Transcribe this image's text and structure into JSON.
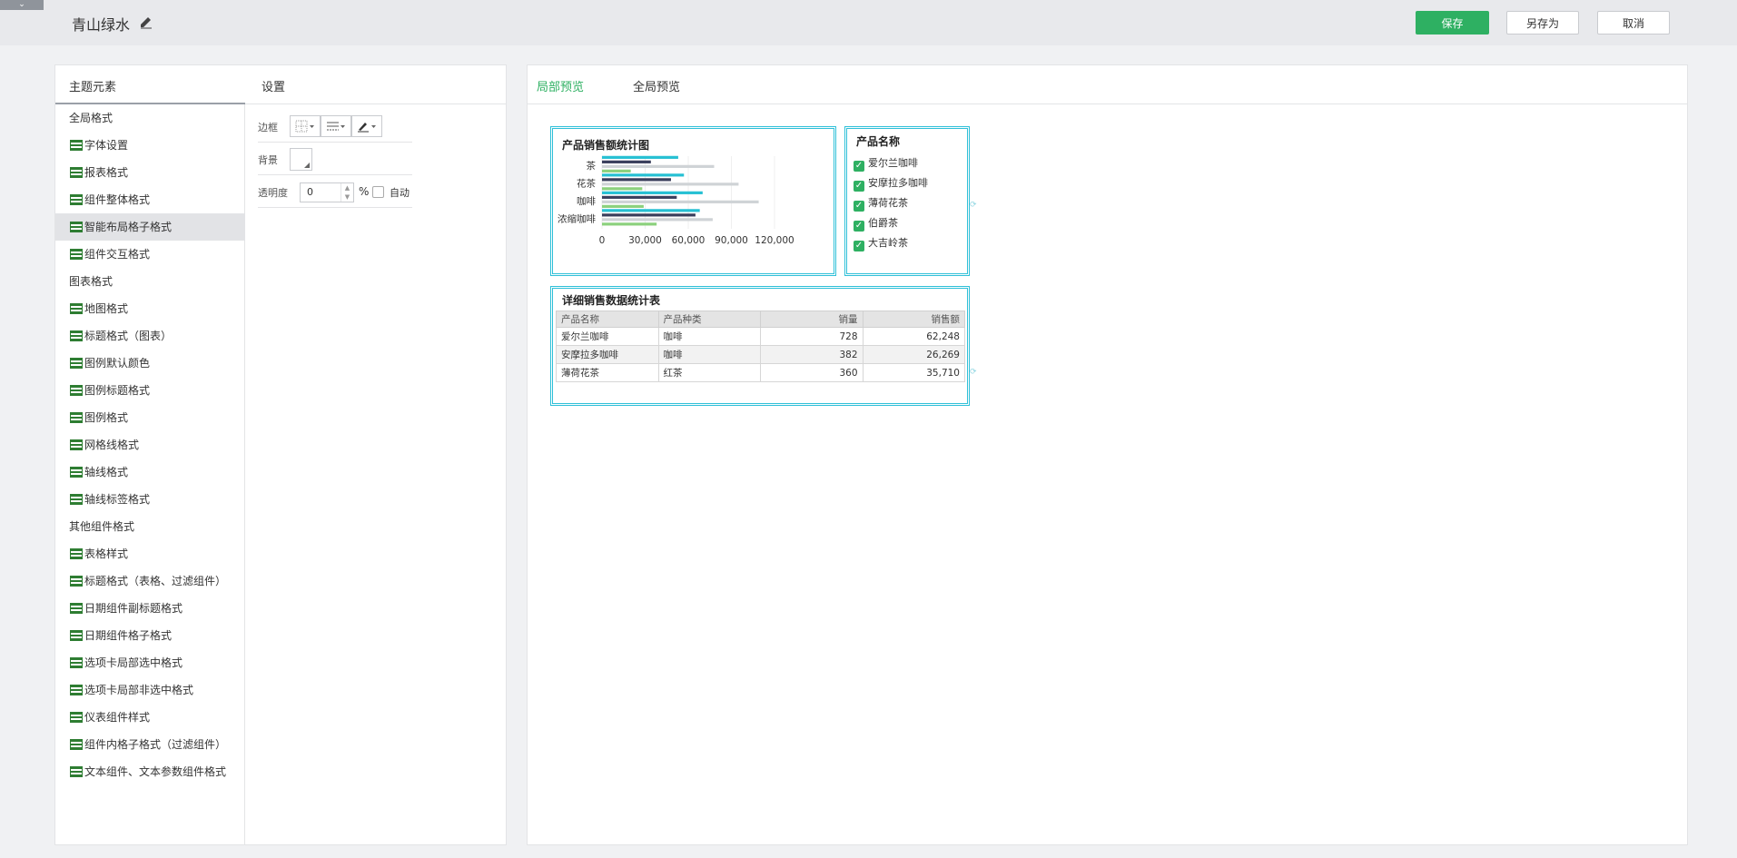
{
  "header": {
    "toggle_glyph": "⌄",
    "title": "青山绿水",
    "buttons": {
      "save": "保存",
      "save_as": "另存为",
      "cancel": "取消"
    }
  },
  "colors": {
    "accent": "#2eb062",
    "widget_border": "#2fc0d8"
  },
  "left": {
    "head_elements": "主题元素",
    "head_settings": "设置",
    "items": [
      {
        "label": "全局格式",
        "group": true
      },
      {
        "label": "字体设置"
      },
      {
        "label": "报表格式"
      },
      {
        "label": "组件整体格式"
      },
      {
        "label": "智能布局格子格式",
        "selected": true
      },
      {
        "label": "组件交互格式"
      },
      {
        "label": "图表格式",
        "group": true
      },
      {
        "label": "地图格式"
      },
      {
        "label": "标题格式（图表）"
      },
      {
        "label": "图例默认颜色"
      },
      {
        "label": "图例标题格式"
      },
      {
        "label": "图例格式"
      },
      {
        "label": "网格线格式"
      },
      {
        "label": "轴线格式"
      },
      {
        "label": "轴线标签格式"
      },
      {
        "label": "其他组件格式",
        "group": true
      },
      {
        "label": "表格样式"
      },
      {
        "label": "标题格式（表格、过滤组件）"
      },
      {
        "label": "日期组件副标题格式"
      },
      {
        "label": "日期组件格子格式"
      },
      {
        "label": "选项卡局部选中格式"
      },
      {
        "label": "选项卡局部非选中格式"
      },
      {
        "label": "仪表组件样式"
      },
      {
        "label": "组件内格子格式（过滤组件）"
      },
      {
        "label": "文本组件、文本参数组件格式"
      }
    ],
    "settings": {
      "border_label": "边框",
      "background_label": "背景",
      "opacity_label": "透明度",
      "opacity_value": "0",
      "percent": "%",
      "auto_label": "自动"
    }
  },
  "right": {
    "tabs": {
      "local": "局部预览",
      "global": "全局预览"
    },
    "chart_widget_title": "产品销售额统计图",
    "filter": {
      "title": "产品名称",
      "options": [
        "爱尔兰咖啡",
        "安摩拉多咖啡",
        "薄荷花茶",
        "伯爵茶",
        "大吉岭茶"
      ]
    },
    "table": {
      "title": "详细销售数据统计表",
      "columns": [
        "产品名称",
        "产品种类",
        "销量",
        "销售额"
      ],
      "rows": [
        [
          "爱尔兰咖啡",
          "咖啡",
          "728",
          "62,248"
        ],
        [
          "安摩拉多咖啡",
          "咖啡",
          "382",
          "26,269"
        ],
        [
          "薄荷花茶",
          "红茶",
          "360",
          "35,710"
        ]
      ]
    }
  },
  "chart_data": {
    "type": "bar",
    "orientation": "horizontal",
    "title": "产品销售额统计图",
    "categories": [
      "茶",
      "花茶",
      "咖啡",
      "浓缩咖啡"
    ],
    "series": [
      {
        "color": "#26c0d3",
        "values": [
          53000,
          57000,
          70000,
          68000
        ]
      },
      {
        "color": "#3a3f5c",
        "values": [
          34000,
          48000,
          52000,
          65000
        ]
      },
      {
        "color": "#cfd3d6",
        "values": [
          78000,
          95000,
          109000,
          77000
        ]
      },
      {
        "color": "#8cd17d",
        "values": [
          20000,
          28000,
          29000,
          38000
        ]
      }
    ],
    "xticks": [
      "0",
      "30,000",
      "60,000",
      "90,000",
      "120,000"
    ],
    "xlim": [
      0,
      120000
    ],
    "grid": true
  }
}
